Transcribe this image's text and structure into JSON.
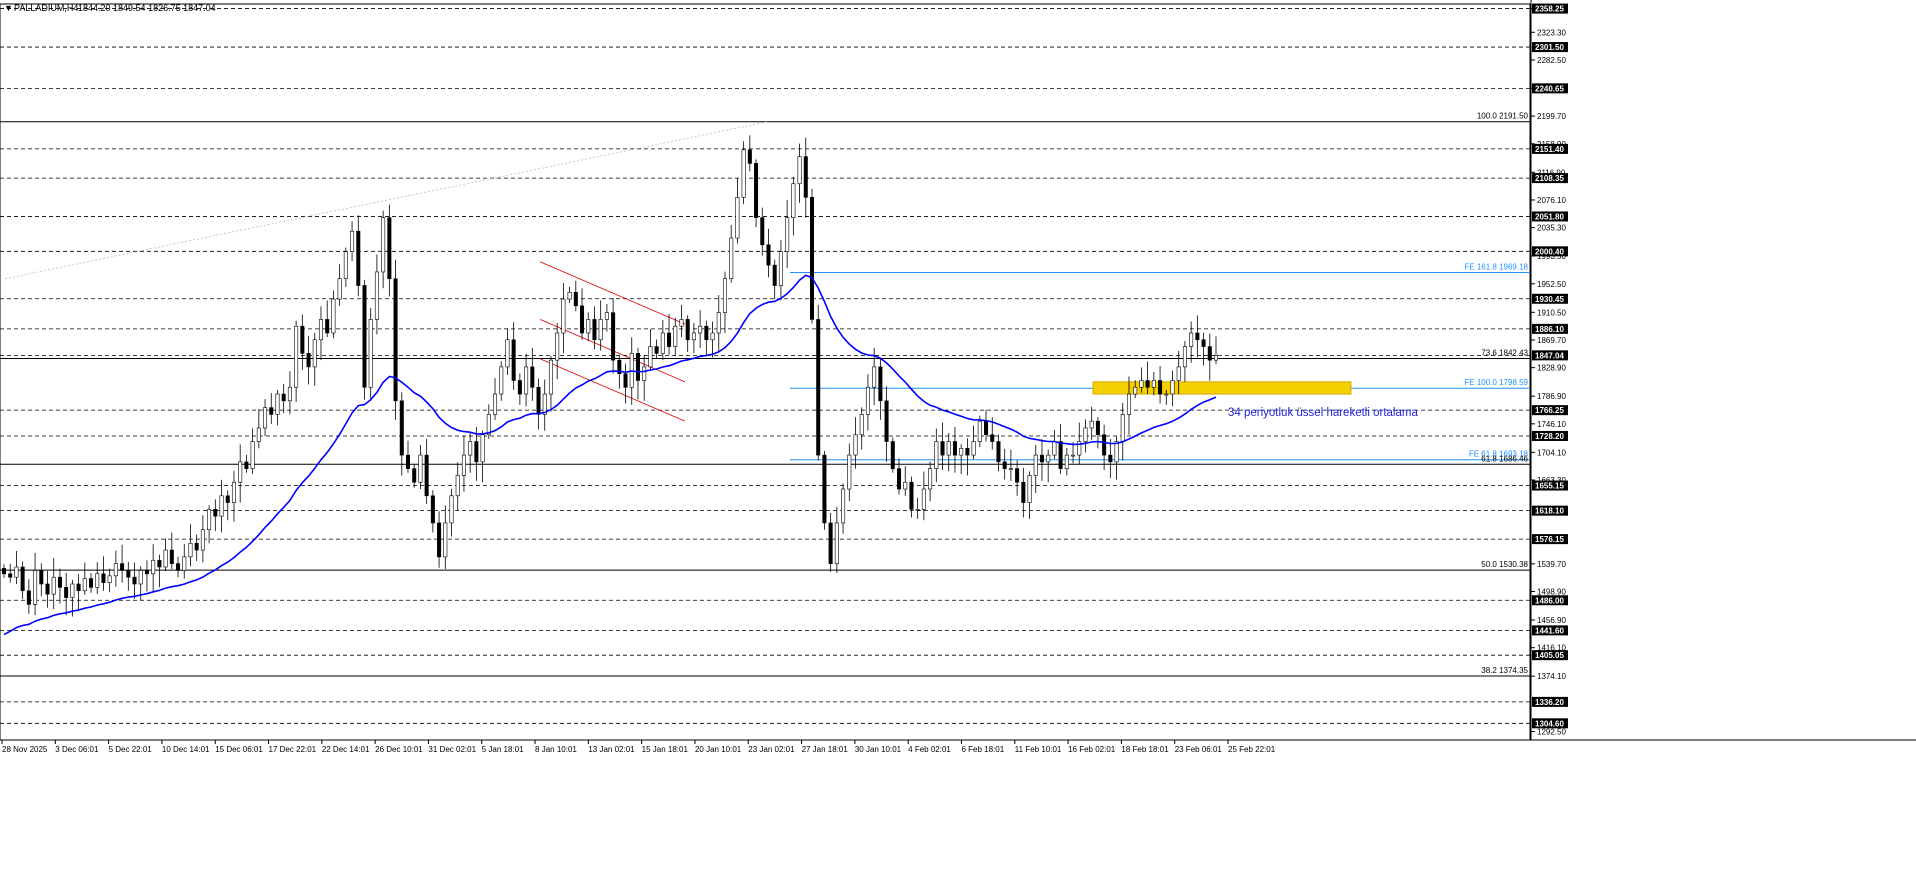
{
  "header": {
    "title": "PALLADIUM,H4",
    "ohlc": "1844.20 1849.54 1826.75 1847.04"
  },
  "chart_data": {
    "type": "candlestick",
    "symbol": "PALLADIUM",
    "timeframe": "H4",
    "ylim": [
      1280,
      2365
    ],
    "price_axis_ticks": [
      "2358.25",
      "2323.30",
      "2282.50",
      "2240.65",
      "2199.70",
      "2158.90",
      "2116.90",
      "2076.10",
      "2035.30",
      "1993.50",
      "1952.50",
      "1910.50",
      "1869.70",
      "1828.90",
      "1786.90",
      "1746.10",
      "1704.10",
      "1663.30",
      "1539.70",
      "1498.90",
      "1456.90",
      "1416.10",
      "1374.10",
      "1292.50"
    ],
    "price_boxes": [
      "2358.25",
      "2301.50",
      "2240.65",
      "2151.40",
      "2108.35",
      "2051.80",
      "2000.40",
      "1930.45",
      "1886.10",
      "1847.04",
      "1766.25",
      "1728.20",
      "1655.15",
      "1618.10",
      "1576.15",
      "1486.00",
      "1441.60",
      "1405.05",
      "1336.20",
      "1304.60"
    ],
    "horizontal_levels": [
      {
        "price": 2191.5,
        "label": "100.0 2191.50",
        "color": "#000000"
      },
      {
        "price": 1969.18,
        "label": "FE 161.8 1969.18",
        "color": "#1e90ff"
      },
      {
        "price": 1842.43,
        "label": "73.6 1842.43",
        "color": "#000000"
      },
      {
        "price": 1798.59,
        "label": "FE 100.0 1798.59",
        "color": "#1e90ff"
      },
      {
        "price": 1693.18,
        "label": "FE 61.8 1693.18",
        "color": "#1e90ff"
      },
      {
        "price": 1686.46,
        "label": "61.8 1686.46",
        "color": "#000000"
      },
      {
        "price": 1530.38,
        "label": "50.0 1530.38",
        "color": "#000000"
      },
      {
        "price": 1374.35,
        "label": "38.2 1374.35",
        "color": "#000000"
      }
    ],
    "time_axis_labels": [
      "28 Nov 2025",
      "3 Dec 06:01",
      "5 Dec 22:01",
      "10 Dec 14:01",
      "15 Dec 06:01",
      "17 Dec 22:01",
      "22 Dec 14:01",
      "26 Dec 10:01",
      "31 Dec 02:01",
      "5 Jan 18:01",
      "8 Jan 10:01",
      "13 Jan 02:01",
      "15 Jan 18:01",
      "20 Jan 10:01",
      "23 Jan 02:01",
      "27 Jan 18:01",
      "30 Jan 10:01",
      "4 Feb 02:01",
      "6 Feb 18:01",
      "11 Feb 10:01",
      "16 Feb 02:01",
      "18 Feb 18:01",
      "23 Feb 06:01",
      "25 Feb 22:01"
    ],
    "price_path": [
      1525,
      1520,
      1535,
      1500,
      1480,
      1530,
      1510,
      1495,
      1520,
      1505,
      1490,
      1510,
      1500,
      1518,
      1505,
      1525,
      1512,
      1522,
      1540,
      1530,
      1520,
      1510,
      1530,
      1525,
      1545,
      1535,
      1560,
      1540,
      1530,
      1550,
      1570,
      1560,
      1590,
      1620,
      1610,
      1640,
      1630,
      1660,
      1690,
      1680,
      1720,
      1740,
      1770,
      1760,
      1790,
      1780,
      1800,
      1890,
      1850,
      1830,
      1870,
      1900,
      1880,
      1930,
      1960,
      2000,
      2030,
      1950,
      1800,
      1900,
      1970,
      2050,
      1960,
      1780,
      1700,
      1680,
      1660,
      1700,
      1640,
      1600,
      1550,
      1600,
      1640,
      1670,
      1700,
      1720,
      1690,
      1730,
      1760,
      1790,
      1830,
      1870,
      1810,
      1790,
      1830,
      1800,
      1760,
      1790,
      1840,
      1880,
      1930,
      1940,
      1920,
      1880,
      1900,
      1870,
      1900,
      1910,
      1840,
      1820,
      1800,
      1850,
      1810,
      1830,
      1860,
      1850,
      1880,
      1860,
      1890,
      1900,
      1870,
      1880,
      1890,
      1870,
      1880,
      1910,
      1960,
      2020,
      2080,
      2150,
      2130,
      2050,
      2010,
      1980,
      1950,
      2000,
      2050,
      2100,
      2140,
      2080,
      1900,
      1700,
      1600,
      1540,
      1600,
      1650,
      1700,
      1730,
      1760,
      1800,
      1830,
      1780,
      1720,
      1680,
      1650,
      1660,
      1620,
      1620,
      1650,
      1680,
      1720,
      1700,
      1720,
      1700,
      1710,
      1700,
      1720,
      1750,
      1730,
      1720,
      1690,
      1680,
      1680,
      1660,
      1630,
      1670,
      1700,
      1690,
      1700,
      1720,
      1680,
      1700,
      1700,
      1720,
      1740,
      1750,
      1730,
      1700,
      1690,
      1720,
      1760,
      1790,
      1800,
      1810,
      1800,
      1810,
      1790,
      1790,
      1810,
      1830,
      1860,
      1880,
      1870,
      1860,
      1840,
      1847
    ],
    "ema_period": 34,
    "ema_color": "#0000ff",
    "parallel_channel": {
      "color": "#dd0000",
      "start_label": "8 Jan 10:01",
      "end_label": "20 Jan 10:01"
    },
    "highlight_zone": {
      "price_low": 1790,
      "price_high": 1808,
      "color": "#f5d000",
      "start_label": "18 Feb 18:01"
    },
    "annotation": "34 periyotluk üssel hareketli ortalama"
  },
  "colors": {
    "background": "#ffffff",
    "candle_up": "#ffffff",
    "candle_down": "#000000",
    "candle_outline": "#000000",
    "grid": "#000000",
    "current_price_box": "#000000"
  }
}
